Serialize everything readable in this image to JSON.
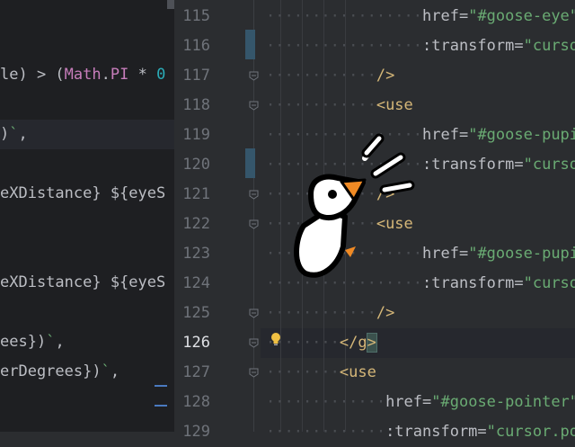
{
  "left_pane": {
    "lines": [
      {
        "text": "le) > (Math.PI * 0",
        "row": 2
      },
      {
        "text": ")`,",
        "row": 4,
        "highlight": true
      },
      {
        "text": "eXDistance} ${eyeS",
        "row": 6
      },
      {
        "text": "eXDistance} ${eyeS",
        "row": 9
      },
      {
        "text": "ees})`,",
        "row": 11
      },
      {
        "text": "erDegrees})`,",
        "row": 12
      }
    ]
  },
  "gutter": {
    "line_numbers": [
      "115",
      "116",
      "117",
      "118",
      "119",
      "120",
      "121",
      "122",
      "123",
      "124",
      "125",
      "126",
      "127",
      "128",
      "129"
    ],
    "current_line": "126"
  },
  "code": {
    "lines": [
      {
        "dots": 4,
        "tag": "",
        "attr": "href",
        "str": "\"#goose-eye\""
      },
      {
        "dots": 4,
        "tag": "",
        "attr": ":transform",
        "str": "\"cursor."
      },
      {
        "dots": 3,
        "tag": "/>",
        "attr": "",
        "str": ""
      },
      {
        "dots": 3,
        "tag": "<use",
        "attr": "",
        "str": ""
      },
      {
        "dots": 4,
        "tag": "",
        "attr": "href",
        "str": "\"#goose-pupil\""
      },
      {
        "dots": 4,
        "tag": "",
        "attr": ":transform",
        "str": "\"cursor."
      },
      {
        "dots": 3,
        "tag": "/>",
        "attr": "",
        "str": ""
      },
      {
        "dots": 3,
        "tag": "<use",
        "attr": "",
        "str": ""
      },
      {
        "dots": 4,
        "tag": "",
        "attr": "href",
        "str": "\"#goose-pupil\""
      },
      {
        "dots": 4,
        "tag": "",
        "attr": ":transform",
        "str": "\"cursor."
      },
      {
        "dots": 3,
        "tag": "/>",
        "attr": "",
        "str": ""
      },
      {
        "dots": 2,
        "tag": "</g>",
        "attr": "",
        "str": ""
      },
      {
        "dots": 2,
        "tag": "<use",
        "attr": "",
        "str": ""
      },
      {
        "dots": 3,
        "tag": "",
        "attr": "href",
        "str": "\"#goose-pointer\""
      },
      {
        "dots": 3,
        "tag": "",
        "attr": ":transform",
        "str": "\"cursor.po"
      }
    ]
  },
  "colors": {
    "tag": "#d5b778",
    "string": "#6aab73",
    "attribute": "#bcbec4",
    "line_number": "#6f737a",
    "background": "#2b2d30"
  },
  "icons": {
    "gutter_bulb": "lightbulb-icon",
    "overlay": "goose-cursor-icon"
  }
}
